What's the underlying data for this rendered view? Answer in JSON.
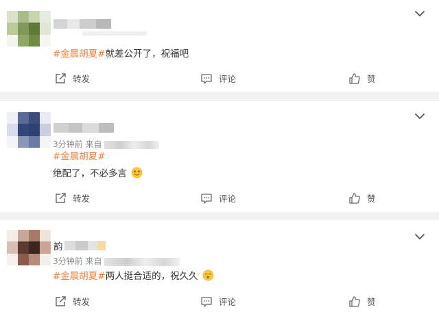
{
  "colors": {
    "topic": "#f08035",
    "page_bg": "#f2f2f2",
    "card_bg": "#ffffff",
    "meta_text": "#8a8a8a"
  },
  "icons": {
    "expand": "chevron-down-icon",
    "share": "share-icon",
    "comment": "comment-icon",
    "like": "thumbs-up-icon"
  },
  "posts": [
    {
      "topic": "#金晨胡夏#",
      "text": "就差公开了，祝福吧",
      "actions": {
        "share": "转发",
        "comment": "评论",
        "like": "赞"
      }
    },
    {
      "meta_time": "3分钟前",
      "meta_source": "来自",
      "topic": "#金晨胡夏#",
      "text": "绝配了，不必多言",
      "emoji": "heart-eyes-emoji",
      "actions": {
        "share": "转发",
        "comment": "评论",
        "like": "赞"
      }
    },
    {
      "name_prefix": "韵",
      "meta_time": "3分钟前",
      "meta_source": "来自",
      "topic": "#金晨胡夏#",
      "text": "两人挺合适的，祝久久",
      "emoji": "kissing-emoji",
      "actions": {
        "share": "转发",
        "comment": "评论",
        "like": "赞"
      }
    }
  ]
}
